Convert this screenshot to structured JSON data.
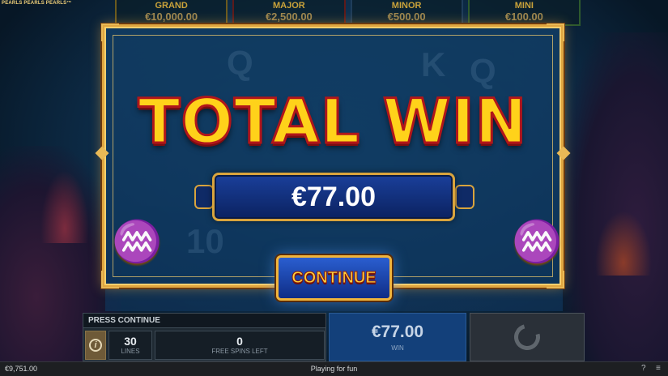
{
  "logo_text": "PEARLS PEARLS PEARLS™",
  "jackpots": [
    {
      "name": "GRAND",
      "value": "€10,000.00"
    },
    {
      "name": "MAJOR",
      "value": "€2,500.00"
    },
    {
      "name": "MINOR",
      "value": "€500.00"
    },
    {
      "name": "MINI",
      "value": "€100.00"
    }
  ],
  "win_popup": {
    "title": "TOTAL WIN",
    "amount": "€77.00",
    "continue_label": "CONTINUE"
  },
  "panel": {
    "message": "PRESS CONTINUE",
    "lines_value": "30",
    "lines_label": "LINES",
    "free_spins_value": "0",
    "free_spins_label": "FREE SPINS LEFT",
    "win_value": "€77.00",
    "win_label": "WIN"
  },
  "status": {
    "balance": "€9,751.00",
    "mode": "Playing for fun",
    "help": "?",
    "menu": "≡"
  },
  "icons": {
    "info": "info-icon",
    "spin": "spin-icon",
    "wave": "wave-icon"
  },
  "colors": {
    "title_yellow": "#ffd21a",
    "title_stroke": "#b1161a",
    "frame_gold": "#e0a640",
    "button_blue": "#2a5ed0"
  }
}
